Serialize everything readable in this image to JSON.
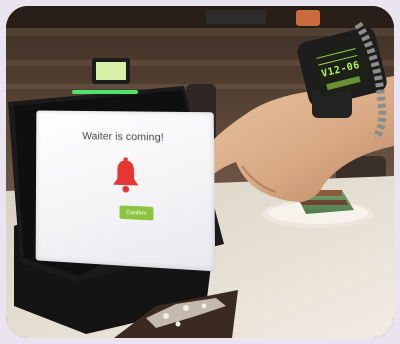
{
  "screen": {
    "title": "Waiter is coming!",
    "confirm_label": "Confirm"
  },
  "watch": {
    "readout": "V12-06"
  },
  "icons": {
    "bell": "bell-icon"
  },
  "colors": {
    "bell": "#e53535",
    "confirm_button": "#8cc43f",
    "watch_display": "#b8f15a"
  }
}
